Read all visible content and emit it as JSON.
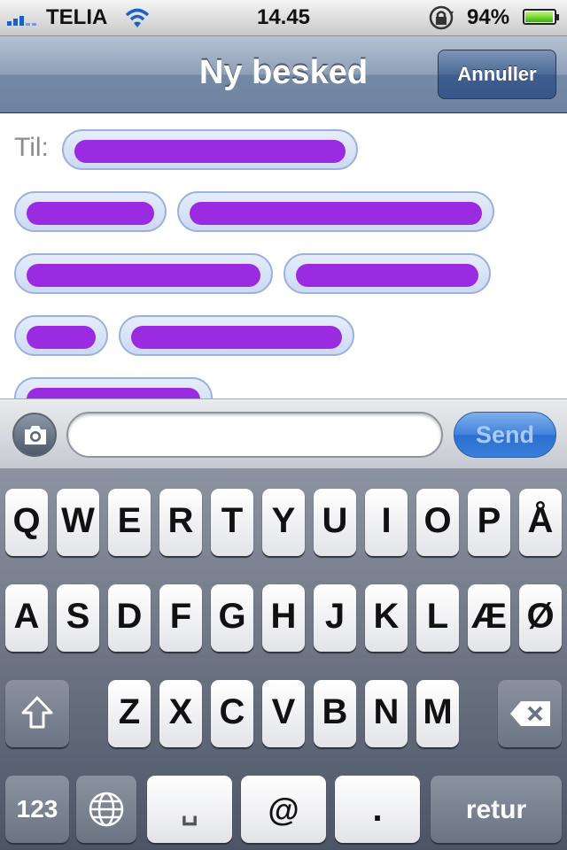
{
  "status_bar": {
    "carrier": "TELIA",
    "time": "14.45",
    "battery": "94%"
  },
  "nav": {
    "title": "Ny besked",
    "cancel_label": "Annuller"
  },
  "recipients": {
    "to_label": "Til:"
  },
  "compose": {
    "send_label": "Send"
  },
  "keyboard": {
    "row1": [
      "Q",
      "W",
      "E",
      "R",
      "T",
      "Y",
      "U",
      "I",
      "O",
      "P",
      "Å"
    ],
    "row2": [
      "A",
      "S",
      "D",
      "F",
      "G",
      "H",
      "J",
      "K",
      "L",
      "Æ",
      "Ø"
    ],
    "row3": [
      "Z",
      "X",
      "C",
      "V",
      "B",
      "N",
      "M"
    ],
    "numbers_label": "123",
    "space_label": "␣",
    "at_label": "@",
    "period_label": ".",
    "return_label": "retur"
  },
  "colors": {
    "nav_blue": "#6d83a1",
    "send_blue": "#3f82db",
    "redaction_purple": "#9a2be0"
  }
}
